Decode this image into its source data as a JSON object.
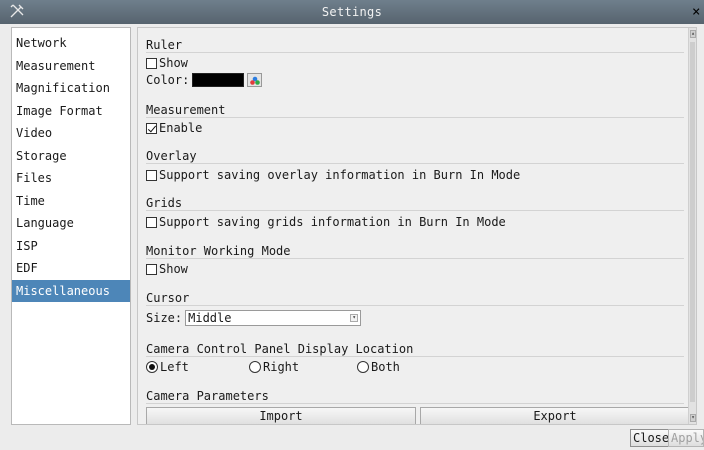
{
  "window": {
    "title": "Settings",
    "app_icon": "tools-icon",
    "close_glyph": "×"
  },
  "sidebar": {
    "items": [
      {
        "label": "Network"
      },
      {
        "label": "Measurement"
      },
      {
        "label": "Magnification"
      },
      {
        "label": "Image Format"
      },
      {
        "label": "Video"
      },
      {
        "label": "Storage"
      },
      {
        "label": "Files"
      },
      {
        "label": "Time"
      },
      {
        "label": "Language"
      },
      {
        "label": "ISP"
      },
      {
        "label": "EDF"
      },
      {
        "label": "Miscellaneous"
      }
    ],
    "selected": "Miscellaneous",
    "selected_color": "#4d86b8"
  },
  "ruler": {
    "title": "Ruler",
    "show_label": "Show",
    "show_checked": false,
    "color_label": "Color:",
    "color_value": "#000000"
  },
  "measurement": {
    "title": "Measurement",
    "enable_label": "Enable",
    "enable_checked": true
  },
  "overlay": {
    "title": "Overlay",
    "option_label": "Support saving overlay information in Burn In Mode",
    "checked": false
  },
  "grids": {
    "title": "Grids",
    "option_label": "Support saving grids information in Burn In Mode",
    "checked": false
  },
  "monitor": {
    "title": "Monitor Working Mode",
    "show_label": "Show",
    "checked": false
  },
  "cursor": {
    "title": "Cursor",
    "size_label": "Size:",
    "size_value": "Middle"
  },
  "camera_panel": {
    "title": "Camera Control Panel Display Location",
    "options": [
      "Left",
      "Right",
      "Both"
    ],
    "selected": "Left"
  },
  "camera_params": {
    "title": "Camera Parameters",
    "import_label": "Import",
    "export_label": "Export"
  },
  "footer": {
    "close_label": "Close",
    "apply_label": "Apply",
    "apply_enabled": false
  }
}
